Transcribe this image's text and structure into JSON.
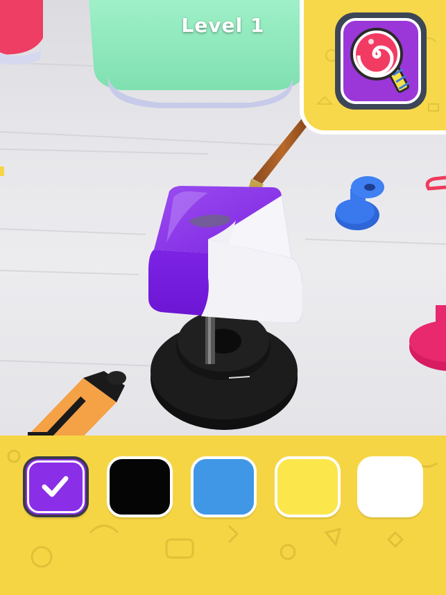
{
  "game": {
    "level_label": "Level 1"
  },
  "target": {
    "icon": "lollipop-icon",
    "card_color": "#9b37d8"
  },
  "palette": {
    "swatches": [
      {
        "name": "purple",
        "color": "#8a2ee8",
        "selected": true
      },
      {
        "name": "black",
        "color": "#050505",
        "selected": false
      },
      {
        "name": "blue",
        "color": "#3f97e6",
        "selected": false
      },
      {
        "name": "yellow",
        "color": "#fbe64c",
        "selected": false
      },
      {
        "name": "white",
        "color": "#ffffff",
        "selected": false
      }
    ]
  },
  "colors": {
    "panel_yellow": "#f6d544",
    "paint_purple": "#8a2ee8",
    "cube_white": "#f2f2f7"
  }
}
